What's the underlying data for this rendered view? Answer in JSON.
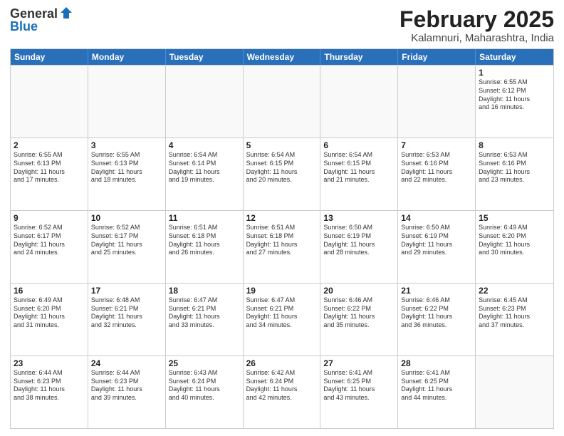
{
  "header": {
    "logo_general": "General",
    "logo_blue": "Blue",
    "title": "February 2025",
    "subtitle": "Kalamnuri, Maharashtra, India"
  },
  "days_of_week": [
    "Sunday",
    "Monday",
    "Tuesday",
    "Wednesday",
    "Thursday",
    "Friday",
    "Saturday"
  ],
  "weeks": [
    [
      {
        "day": "",
        "lines": []
      },
      {
        "day": "",
        "lines": []
      },
      {
        "day": "",
        "lines": []
      },
      {
        "day": "",
        "lines": []
      },
      {
        "day": "",
        "lines": []
      },
      {
        "day": "",
        "lines": []
      },
      {
        "day": "1",
        "lines": [
          "Sunrise: 6:55 AM",
          "Sunset: 6:12 PM",
          "Daylight: 11 hours",
          "and 16 minutes."
        ]
      }
    ],
    [
      {
        "day": "2",
        "lines": [
          "Sunrise: 6:55 AM",
          "Sunset: 6:13 PM",
          "Daylight: 11 hours",
          "and 17 minutes."
        ]
      },
      {
        "day": "3",
        "lines": [
          "Sunrise: 6:55 AM",
          "Sunset: 6:13 PM",
          "Daylight: 11 hours",
          "and 18 minutes."
        ]
      },
      {
        "day": "4",
        "lines": [
          "Sunrise: 6:54 AM",
          "Sunset: 6:14 PM",
          "Daylight: 11 hours",
          "and 19 minutes."
        ]
      },
      {
        "day": "5",
        "lines": [
          "Sunrise: 6:54 AM",
          "Sunset: 6:15 PM",
          "Daylight: 11 hours",
          "and 20 minutes."
        ]
      },
      {
        "day": "6",
        "lines": [
          "Sunrise: 6:54 AM",
          "Sunset: 6:15 PM",
          "Daylight: 11 hours",
          "and 21 minutes."
        ]
      },
      {
        "day": "7",
        "lines": [
          "Sunrise: 6:53 AM",
          "Sunset: 6:16 PM",
          "Daylight: 11 hours",
          "and 22 minutes."
        ]
      },
      {
        "day": "8",
        "lines": [
          "Sunrise: 6:53 AM",
          "Sunset: 6:16 PM",
          "Daylight: 11 hours",
          "and 23 minutes."
        ]
      }
    ],
    [
      {
        "day": "9",
        "lines": [
          "Sunrise: 6:52 AM",
          "Sunset: 6:17 PM",
          "Daylight: 11 hours",
          "and 24 minutes."
        ]
      },
      {
        "day": "10",
        "lines": [
          "Sunrise: 6:52 AM",
          "Sunset: 6:17 PM",
          "Daylight: 11 hours",
          "and 25 minutes."
        ]
      },
      {
        "day": "11",
        "lines": [
          "Sunrise: 6:51 AM",
          "Sunset: 6:18 PM",
          "Daylight: 11 hours",
          "and 26 minutes."
        ]
      },
      {
        "day": "12",
        "lines": [
          "Sunrise: 6:51 AM",
          "Sunset: 6:18 PM",
          "Daylight: 11 hours",
          "and 27 minutes."
        ]
      },
      {
        "day": "13",
        "lines": [
          "Sunrise: 6:50 AM",
          "Sunset: 6:19 PM",
          "Daylight: 11 hours",
          "and 28 minutes."
        ]
      },
      {
        "day": "14",
        "lines": [
          "Sunrise: 6:50 AM",
          "Sunset: 6:19 PM",
          "Daylight: 11 hours",
          "and 29 minutes."
        ]
      },
      {
        "day": "15",
        "lines": [
          "Sunrise: 6:49 AM",
          "Sunset: 6:20 PM",
          "Daylight: 11 hours",
          "and 30 minutes."
        ]
      }
    ],
    [
      {
        "day": "16",
        "lines": [
          "Sunrise: 6:49 AM",
          "Sunset: 6:20 PM",
          "Daylight: 11 hours",
          "and 31 minutes."
        ]
      },
      {
        "day": "17",
        "lines": [
          "Sunrise: 6:48 AM",
          "Sunset: 6:21 PM",
          "Daylight: 11 hours",
          "and 32 minutes."
        ]
      },
      {
        "day": "18",
        "lines": [
          "Sunrise: 6:47 AM",
          "Sunset: 6:21 PM",
          "Daylight: 11 hours",
          "and 33 minutes."
        ]
      },
      {
        "day": "19",
        "lines": [
          "Sunrise: 6:47 AM",
          "Sunset: 6:21 PM",
          "Daylight: 11 hours",
          "and 34 minutes."
        ]
      },
      {
        "day": "20",
        "lines": [
          "Sunrise: 6:46 AM",
          "Sunset: 6:22 PM",
          "Daylight: 11 hours",
          "and 35 minutes."
        ]
      },
      {
        "day": "21",
        "lines": [
          "Sunrise: 6:46 AM",
          "Sunset: 6:22 PM",
          "Daylight: 11 hours",
          "and 36 minutes."
        ]
      },
      {
        "day": "22",
        "lines": [
          "Sunrise: 6:45 AM",
          "Sunset: 6:23 PM",
          "Daylight: 11 hours",
          "and 37 minutes."
        ]
      }
    ],
    [
      {
        "day": "23",
        "lines": [
          "Sunrise: 6:44 AM",
          "Sunset: 6:23 PM",
          "Daylight: 11 hours",
          "and 38 minutes."
        ]
      },
      {
        "day": "24",
        "lines": [
          "Sunrise: 6:44 AM",
          "Sunset: 6:23 PM",
          "Daylight: 11 hours",
          "and 39 minutes."
        ]
      },
      {
        "day": "25",
        "lines": [
          "Sunrise: 6:43 AM",
          "Sunset: 6:24 PM",
          "Daylight: 11 hours",
          "and 40 minutes."
        ]
      },
      {
        "day": "26",
        "lines": [
          "Sunrise: 6:42 AM",
          "Sunset: 6:24 PM",
          "Daylight: 11 hours",
          "and 42 minutes."
        ]
      },
      {
        "day": "27",
        "lines": [
          "Sunrise: 6:41 AM",
          "Sunset: 6:25 PM",
          "Daylight: 11 hours",
          "and 43 minutes."
        ]
      },
      {
        "day": "28",
        "lines": [
          "Sunrise: 6:41 AM",
          "Sunset: 6:25 PM",
          "Daylight: 11 hours",
          "and 44 minutes."
        ]
      },
      {
        "day": "",
        "lines": []
      }
    ]
  ]
}
